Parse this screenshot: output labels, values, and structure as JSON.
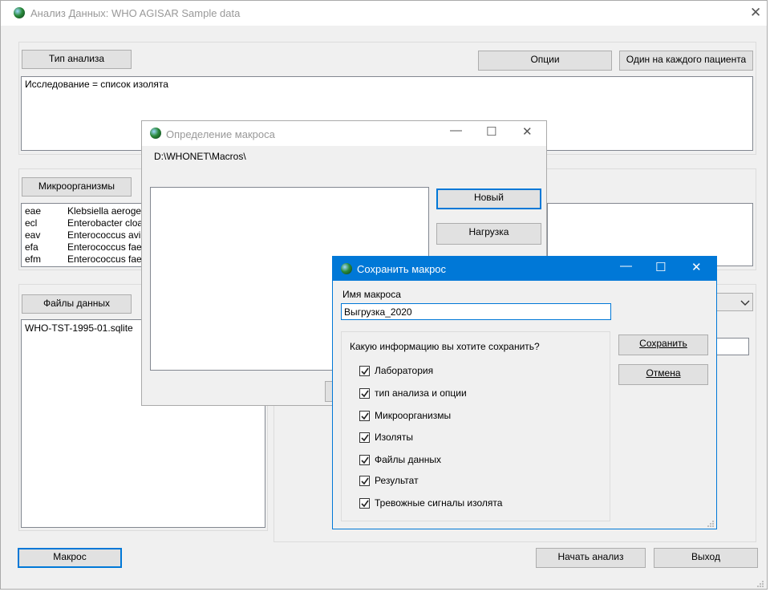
{
  "main": {
    "title": "Анализ Данных: WHO AGISAR Sample data",
    "analysis_type_button": "Тип анализа",
    "options_button": "Опции",
    "one_per_patient_button": "Один на каждого пациента",
    "analysis_summary": "Исследование = список изолята",
    "microorganisms_button": "Микроорганизмы",
    "organisms": [
      {
        "code": "eae",
        "name": "Klebsiella aerogenes"
      },
      {
        "code": "ecl",
        "name": "Enterobacter cloacae"
      },
      {
        "code": "eav",
        "name": "Enterococcus avium"
      },
      {
        "code": "efa",
        "name": "Enterococcus faecalis"
      },
      {
        "code": "efm",
        "name": "Enterococcus faecium"
      }
    ],
    "data_files_button": "Файлы данных",
    "data_files": [
      "WHO-TST-1995-01.sqlite"
    ],
    "macro_button": "Макрос",
    "start_analysis_button": "Начать анализ",
    "exit_button": "Выход"
  },
  "macro_def": {
    "title": "Определение макроса",
    "path": "D:\\WHONET\\Macros\\",
    "new_button": "Новый",
    "load_button": "Нагрузка"
  },
  "save_macro": {
    "title": "Сохранить макрос",
    "name_label": "Имя макроса",
    "name_value": "Выгрузка_2020",
    "question": "Какую информацию вы хотите сохранить?",
    "options": [
      {
        "label": "Лаборатория",
        "checked": true
      },
      {
        "label": "тип анализа и опции",
        "checked": true
      },
      {
        "label": "Микроорганизмы",
        "checked": true
      },
      {
        "label": "Изоляты",
        "checked": true
      },
      {
        "label": "Файлы данных",
        "checked": true
      },
      {
        "label": "Результат",
        "checked": true
      },
      {
        "label": "Тревожные сигналы изолята",
        "checked": true
      }
    ],
    "save_button": "Сохранить",
    "cancel_button": "Отмена"
  },
  "colors": {
    "accent": "#0078d7",
    "window_bg": "#f0f0f0",
    "button_bg": "#e1e1e1"
  }
}
